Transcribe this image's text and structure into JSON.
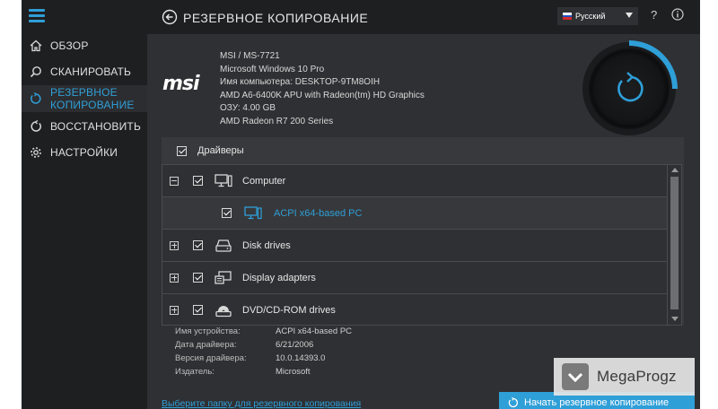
{
  "sidebar": {
    "items": [
      {
        "label": "ОБЗОР",
        "icon": "home-icon"
      },
      {
        "label": "СКАНИРОВАТЬ",
        "icon": "search-icon"
      },
      {
        "label_line1": "РЕЗЕРВНОЕ",
        "label_line2": "КОПИРОВАНИЕ",
        "icon": "backup-icon",
        "active": true
      },
      {
        "label": "ВОССТАНОВИТЬ",
        "icon": "restore-icon"
      },
      {
        "label": "НАСТРОЙКИ",
        "icon": "gear-icon"
      }
    ]
  },
  "header": {
    "title": "РЕЗЕРВНОЕ КОПИРОВАНИЕ",
    "language": "Русский",
    "help_label": "?"
  },
  "system": {
    "brand": "msi",
    "model": "MSI / MS-7721",
    "os": "Microsoft Windows 10 Pro",
    "computer_name": "Имя компьютера: DESKTOP-9TM8OIH",
    "cpu": "AMD A6-6400K APU with Radeon(tm) HD Graphics",
    "ram": "ОЗУ: 4.00 GB",
    "gpu": "AMD Radeon R7 200 Series"
  },
  "drivers": {
    "label": "Драйверы",
    "rows": [
      {
        "label": "Computer",
        "expander": "minus",
        "icon": "monitor-icon"
      },
      {
        "label": "ACPI x64-based PC",
        "child": true,
        "icon": "monitor-icon"
      },
      {
        "label": "Disk drives",
        "expander": "plus",
        "icon": "disk-drive-icon"
      },
      {
        "label": "Display adapters",
        "expander": "plus",
        "icon": "display-adapter-icon"
      },
      {
        "label": "DVD/CD-ROM drives",
        "expander": "plus",
        "icon": "dvd-drive-icon"
      }
    ]
  },
  "details": {
    "device_name_key": "Имя устройства:",
    "device_name_value": "ACPI x64-based PC",
    "driver_date_key": "Дата драйвера:",
    "driver_date_value": "6/21/2006",
    "driver_version_key": "Версия драйвера:",
    "driver_version_value": "10.0.14393.0",
    "publisher_key": "Издатель:",
    "publisher_value": "Microsoft"
  },
  "footer": {
    "folder_link": "Выберите папку для резервного копирования",
    "start_button": "Начать резервное копирование"
  },
  "watermark": {
    "text": "MegaProgz"
  },
  "colors": {
    "accent": "#2f9fd8",
    "sidebar_bg": "#1e1f21",
    "content_bg": "#2f3033"
  }
}
